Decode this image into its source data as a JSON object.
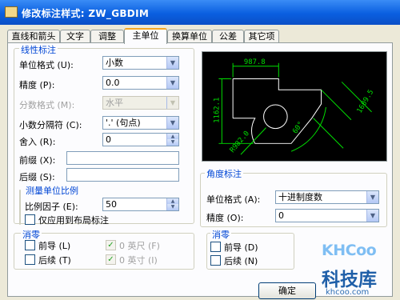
{
  "window": {
    "title": "修改标注样式: ZW_GBDIM"
  },
  "tabs": [
    {
      "label": "直线和箭头"
    },
    {
      "label": "文字"
    },
    {
      "label": "调整"
    },
    {
      "label": "主单位"
    },
    {
      "label": "换算单位"
    },
    {
      "label": "公差"
    },
    {
      "label": "其它项"
    }
  ],
  "linear": {
    "title": "线性标注",
    "unit_format_label": "单位格式 (U):",
    "unit_format_value": "小数",
    "precision_label": "精度 (P):",
    "precision_value": "0.0",
    "fraction_label": "分数格式 (M):",
    "fraction_value": "水平",
    "decimal_sep_label": "小数分隔符 (C):",
    "decimal_sep_value": "'.' (句点)",
    "round_label": "舍入 (R):",
    "round_value": "0",
    "prefix_label": "前缀 (X):",
    "prefix_value": "",
    "suffix_label": "后缀 (S):",
    "suffix_value": ""
  },
  "scale": {
    "title": "测量单位比例",
    "factor_label": "比例因子 (E):",
    "factor_value": "50",
    "layout_only_label": "仅应用到布局标注"
  },
  "zero_linear": {
    "title": "消零",
    "leading_label": "前导 (L)",
    "trailing_label": "后续 (T)",
    "feet_label": "0 英尺 (F)",
    "inches_label": "0 英寸 (I)",
    "check_mark": "✓"
  },
  "angular": {
    "title": "角度标注",
    "unit_format_label": "单位格式 (A):",
    "unit_format_value": "十进制度数",
    "precision_label": "精度 (O):",
    "precision_value": "0"
  },
  "zero_angular": {
    "title": "消零",
    "leading_label": "前导 (D)",
    "trailing_label": "后续 (N)"
  },
  "preview": {
    "dim_top": "987.8",
    "dim_left": "1162.1",
    "dim_right": "1609.5",
    "dim_bottom": "R982.0",
    "dim_angle": "60°"
  },
  "buttons": {
    "ok_label": "确定"
  },
  "watermark": {
    "brand": "KHCoo",
    "cn": "科技库",
    "url": "khcoo.com"
  },
  "arrow_glyph": "▼"
}
